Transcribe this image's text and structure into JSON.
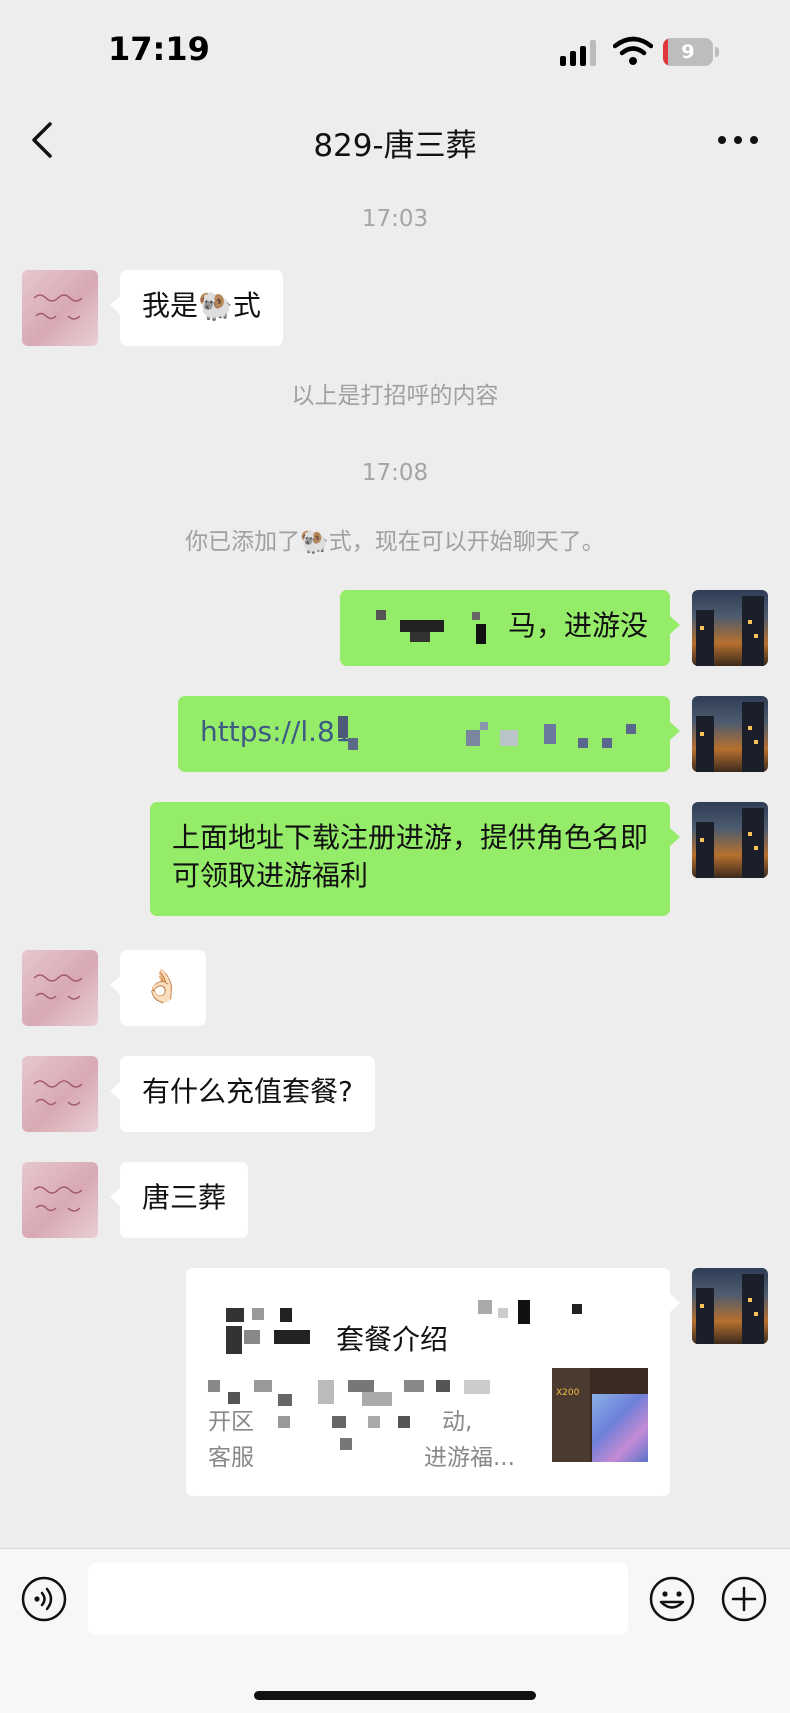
{
  "status_bar": {
    "time": "17:19",
    "battery": "9",
    "battery_level": 0.09
  },
  "header": {
    "title": "829-唐三葬"
  },
  "messages": {
    "time_1": "17:03",
    "m1_text": "我是🐏式",
    "greeting_note": "以上是打招呼的内容",
    "time_2": "17:08",
    "added_note": "你已添加了🐏式，现在可以开始聊天了。",
    "m2_text": "马，进游没",
    "m3_link": "https://l.81",
    "m4_text": "上面地址下载注册进游，提供角色名即可领取进游福利",
    "m5_emoji": "👌🏻",
    "m6_text": "有什么充值套餐?",
    "m7_text": "唐三葬",
    "card": {
      "title_tail": "套餐介绍",
      "desc_line1_start": "开区",
      "desc_line1_end": "动,",
      "desc_line2_start": "客服",
      "desc_line2_end": "进游福...",
      "thumb_label": "X200"
    }
  },
  "icons": {
    "back": "chevron-left-icon",
    "more": "more-dots-icon",
    "voice": "voice-input-icon",
    "emoji": "emoji-icon",
    "plus": "plus-icon"
  },
  "colors": {
    "background": "#ededed",
    "outgoing_bubble": "#95ec69",
    "incoming_bubble": "#ffffff",
    "link": "#3d5a85"
  }
}
